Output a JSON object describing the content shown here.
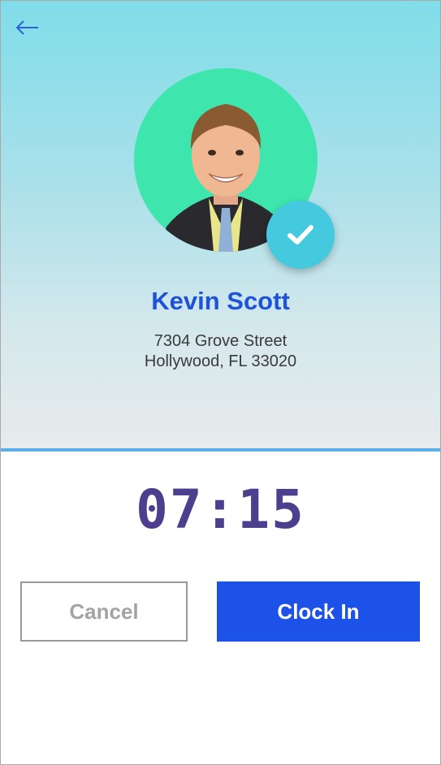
{
  "header": {
    "back_icon": "arrow-left-icon"
  },
  "profile": {
    "name": "Kevin Scott",
    "address_line1": "7304 Grove Street",
    "address_line2": "Hollywood, FL 33020",
    "avatar_bg_color": "#3ee6ad",
    "verified_icon": "check-icon",
    "verified_badge_color": "#45c9de"
  },
  "clock": {
    "time": "07:15",
    "time_color": "#4e3e8e"
  },
  "actions": {
    "cancel_label": "Cancel",
    "clock_in_label": "Clock In",
    "primary_color": "#1d52e8"
  }
}
